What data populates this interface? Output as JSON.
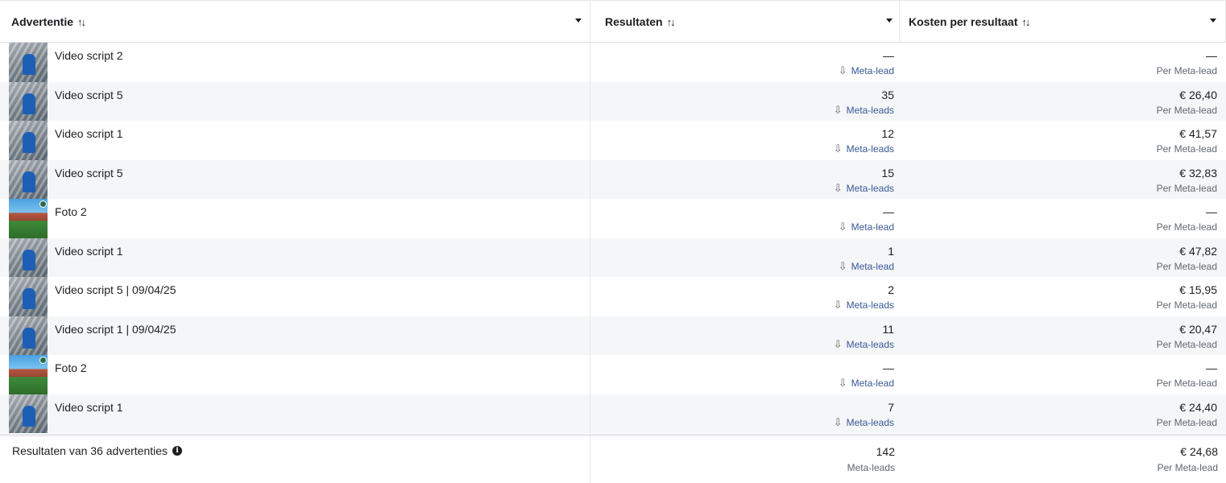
{
  "header": {
    "col_ad": "Advertentie",
    "col_results": "Resultaten",
    "col_cost": "Kosten per resultaat",
    "sort_glyph": "↑↓"
  },
  "rows": [
    {
      "name": "Video script 2",
      "thumb": "video",
      "result": "—",
      "result_label": "Meta-lead",
      "cost": "—",
      "cost_label": "Per Meta-lead"
    },
    {
      "name": "Video script 5",
      "thumb": "video",
      "result": "35",
      "result_label": "Meta-leads",
      "cost": "€ 26,40",
      "cost_label": "Per Meta-lead"
    },
    {
      "name": "Video script 1",
      "thumb": "video",
      "result": "12",
      "result_label": "Meta-leads",
      "cost": "€ 41,57",
      "cost_label": "Per Meta-lead"
    },
    {
      "name": "Video script 5",
      "thumb": "video",
      "result": "15",
      "result_label": "Meta-leads",
      "cost": "€ 32,83",
      "cost_label": "Per Meta-lead"
    },
    {
      "name": "Foto 2",
      "thumb": "photo",
      "result": "—",
      "result_label": "Meta-lead",
      "cost": "—",
      "cost_label": "Per Meta-lead"
    },
    {
      "name": "Video script 1",
      "thumb": "video",
      "result": "1",
      "result_label": "Meta-lead",
      "cost": "€ 47,82",
      "cost_label": "Per Meta-lead"
    },
    {
      "name": "Video script 5 | 09/04/25",
      "thumb": "video",
      "result": "2",
      "result_label": "Meta-leads",
      "cost": "€ 15,95",
      "cost_label": "Per Meta-lead"
    },
    {
      "name": "Video script 1 | 09/04/25",
      "thumb": "video",
      "result": "11",
      "result_label": "Meta-leads",
      "cost": "€ 20,47",
      "cost_label": "Per Meta-lead"
    },
    {
      "name": "Foto 2",
      "thumb": "photo",
      "result": "—",
      "result_label": "Meta-lead",
      "cost": "—",
      "cost_label": "Per Meta-lead"
    },
    {
      "name": "Video script 1",
      "thumb": "video",
      "result": "7",
      "result_label": "Meta-leads",
      "cost": "€ 24,40",
      "cost_label": "Per Meta-lead"
    }
  ],
  "footer": {
    "title": "Resultaten van 36 advertenties",
    "info_glyph": "i",
    "total_results": "142",
    "total_results_label": "Meta-leads",
    "total_cost": "€ 24,68",
    "total_cost_label": "Per Meta-lead"
  },
  "icons": {
    "download": "⇩"
  }
}
